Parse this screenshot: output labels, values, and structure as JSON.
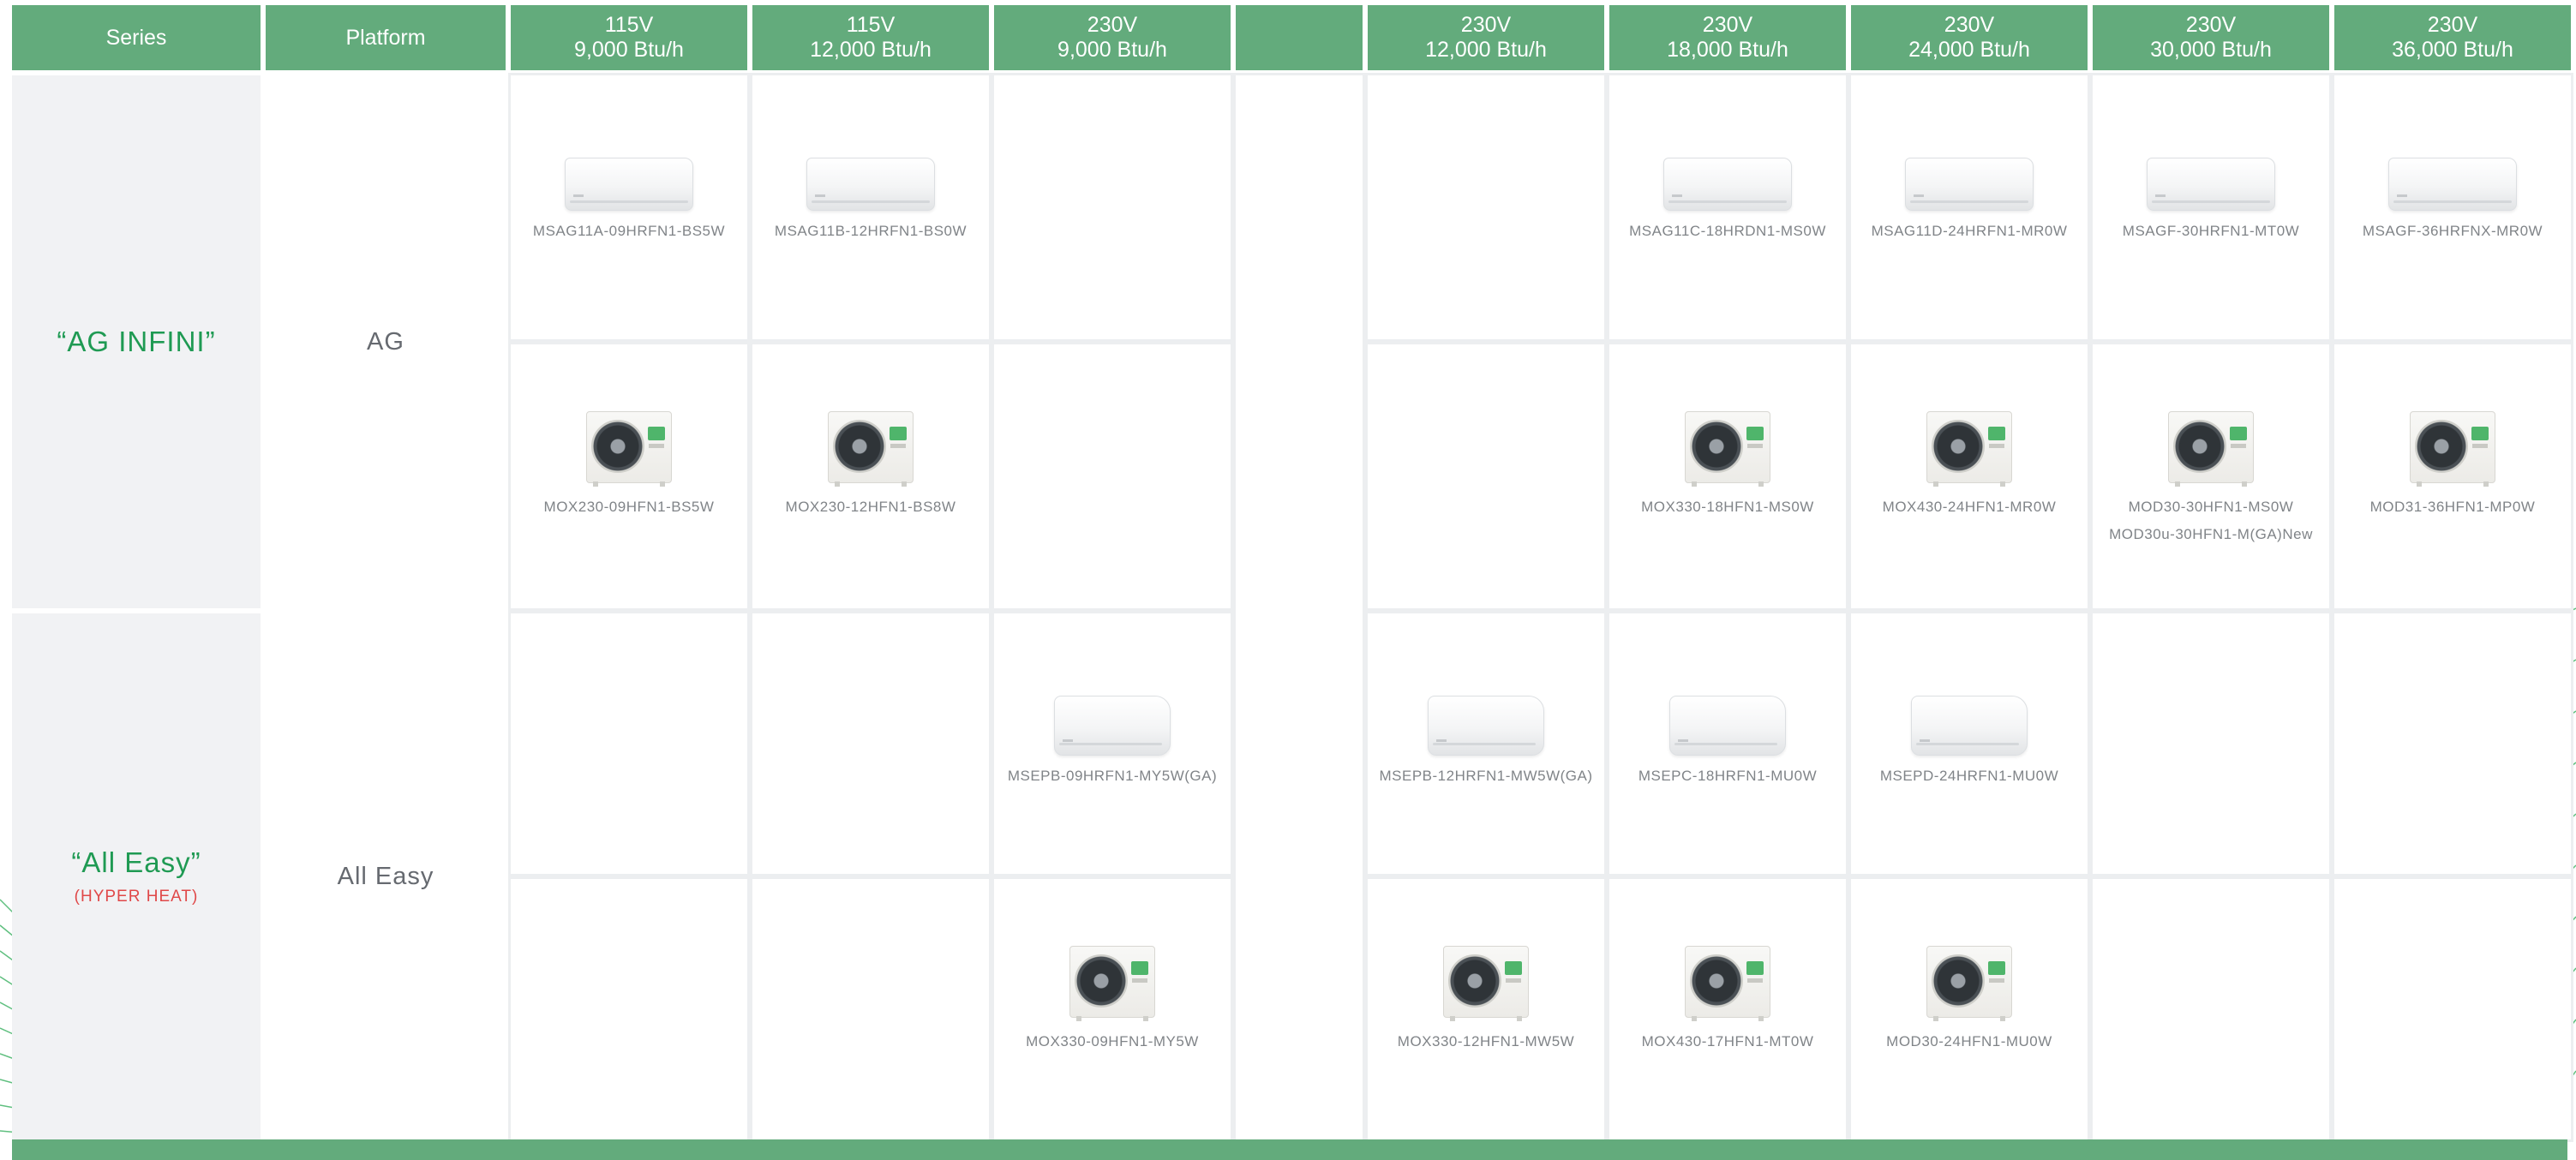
{
  "headers": [
    {
      "line1": "Series",
      "line2": ""
    },
    {
      "line1": "Platform",
      "line2": ""
    },
    {
      "line1": "115V",
      "line2": "9,000 Btu/h"
    },
    {
      "line1": "115V",
      "line2": "12,000 Btu/h"
    },
    {
      "line1": "230V",
      "line2": "9,000 Btu/h"
    },
    {
      "line1": "",
      "line2": ""
    },
    {
      "line1": "230V",
      "line2": "12,000 Btu/h"
    },
    {
      "line1": "230V",
      "line2": "18,000 Btu/h"
    },
    {
      "line1": "230V",
      "line2": "24,000 Btu/h"
    },
    {
      "line1": "230V",
      "line2": "30,000 Btu/h"
    },
    {
      "line1": "230V",
      "line2": "36,000 Btu/h"
    }
  ],
  "series": [
    {
      "name": "“AG INFINI”",
      "sub": "",
      "platform": "AG",
      "indoor": [
        "MSAG11A-09HRFN1-BS5W",
        "MSAG11B-12HRFN1-BS0W",
        "",
        "",
        "MSAG11C-18HRDN1-MS0W",
        "MSAG11D-24HRFN1-MR0W",
        "MSAGF-30HRFN1-MT0W",
        "MSAGF-36HRFNX-MR0W"
      ],
      "outdoor": [
        "MOX230-09HFN1-BS5W",
        "MOX230-12HFN1-BS8W",
        "",
        "",
        "MOX330-18HFN1-MS0W",
        "MOX430-24HFN1-MR0W",
        "MOD30-30HFN1-MS0W",
        "MOD31-36HFN1-MP0W"
      ],
      "outdoor_extra": "MOD30u-30HFN1-M(GA)New"
    },
    {
      "name": "“All Easy”",
      "sub": "(HYPER HEAT)",
      "platform": "All Easy",
      "indoor": [
        "",
        "",
        "MSEPB-09HRFN1-MY5W(GA)",
        "MSEPB-12HRFN1-MW5W(GA)",
        "MSEPC-18HRFN1-MU0W",
        "MSEPD-24HRFN1-MU0W",
        "",
        ""
      ],
      "outdoor": [
        "",
        "",
        "MOX330-09HFN1-MY5W",
        "MOX330-12HFN1-MW5W",
        "MOX430-17HFN1-MT0W",
        "MOD30-24HFN1-MU0W",
        "",
        ""
      ]
    }
  ],
  "colors": {
    "header_bg": "#63ab7c",
    "series_name": "#1f9a53",
    "series_sub": "#e04848",
    "series_bg": "#f1f2f4"
  }
}
